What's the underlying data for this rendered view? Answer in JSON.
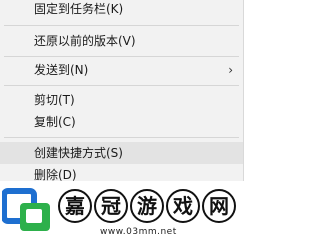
{
  "context_menu": {
    "items": [
      {
        "label": "固定到任务栏(K)"
      },
      {
        "label": "还原以前的版本(V)"
      },
      {
        "label": "发送到(N)",
        "submenu_arrow": "›"
      },
      {
        "label": "剪切(T)"
      },
      {
        "label": "复制(C)"
      },
      {
        "label": "创建快捷方式(S)",
        "highlighted": true
      },
      {
        "label": "删除(D)"
      }
    ]
  },
  "watermark": {
    "chars": [
      "嘉",
      "冠",
      "游",
      "戏",
      "网"
    ],
    "url": "www.03mm.net",
    "logo_icon": "green-blue-square-logo",
    "logo_colors": {
      "green": "#2db04b",
      "blue": "#1e6fd0"
    }
  }
}
